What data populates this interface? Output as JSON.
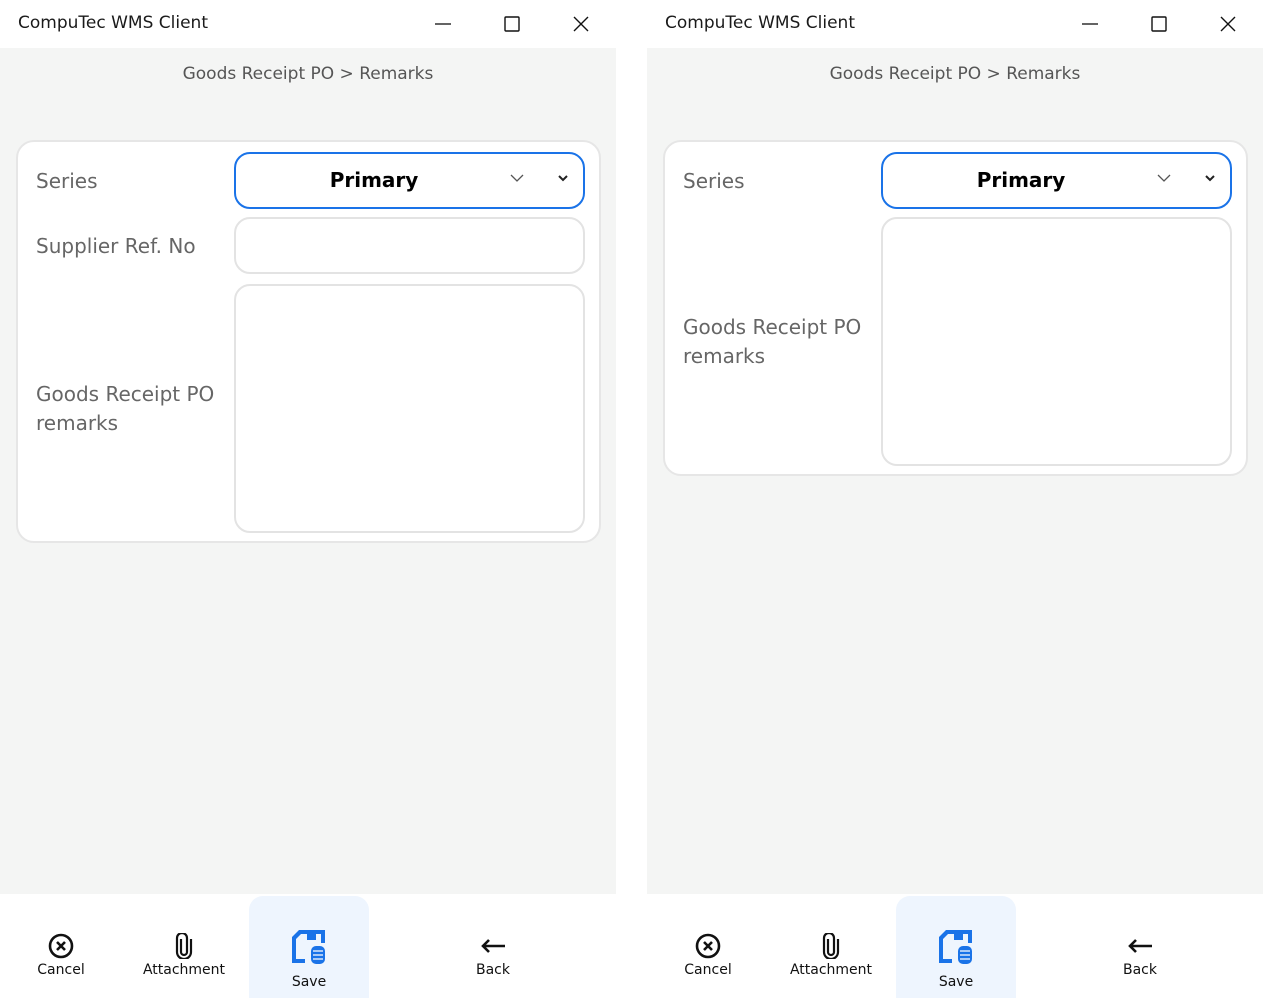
{
  "windows": [
    {
      "title": "CompuTec WMS Client",
      "breadcrumb": "Goods Receipt PO > Remarks",
      "series_label": "Series",
      "series_value": "Primary",
      "supplier_ref_label": "Supplier Ref. No",
      "supplier_ref_value": "",
      "remarks_label": "Goods Receipt PO remarks",
      "remarks_value": "",
      "bottom": {
        "cancel": "Cancel",
        "attachment": "Attachment",
        "save": "Save",
        "back": "Back"
      }
    },
    {
      "title": "CompuTec WMS Client",
      "breadcrumb": "Goods Receipt PO > Remarks",
      "series_label": "Series",
      "series_value": "Primary",
      "remarks_label": "Goods Receipt PO remarks",
      "remarks_value": "",
      "bottom": {
        "cancel": "Cancel",
        "attachment": "Attachment",
        "save": "Save",
        "back": "Back"
      }
    }
  ],
  "colors": {
    "accent": "#1a73e8",
    "background": "#f4f5f4"
  }
}
